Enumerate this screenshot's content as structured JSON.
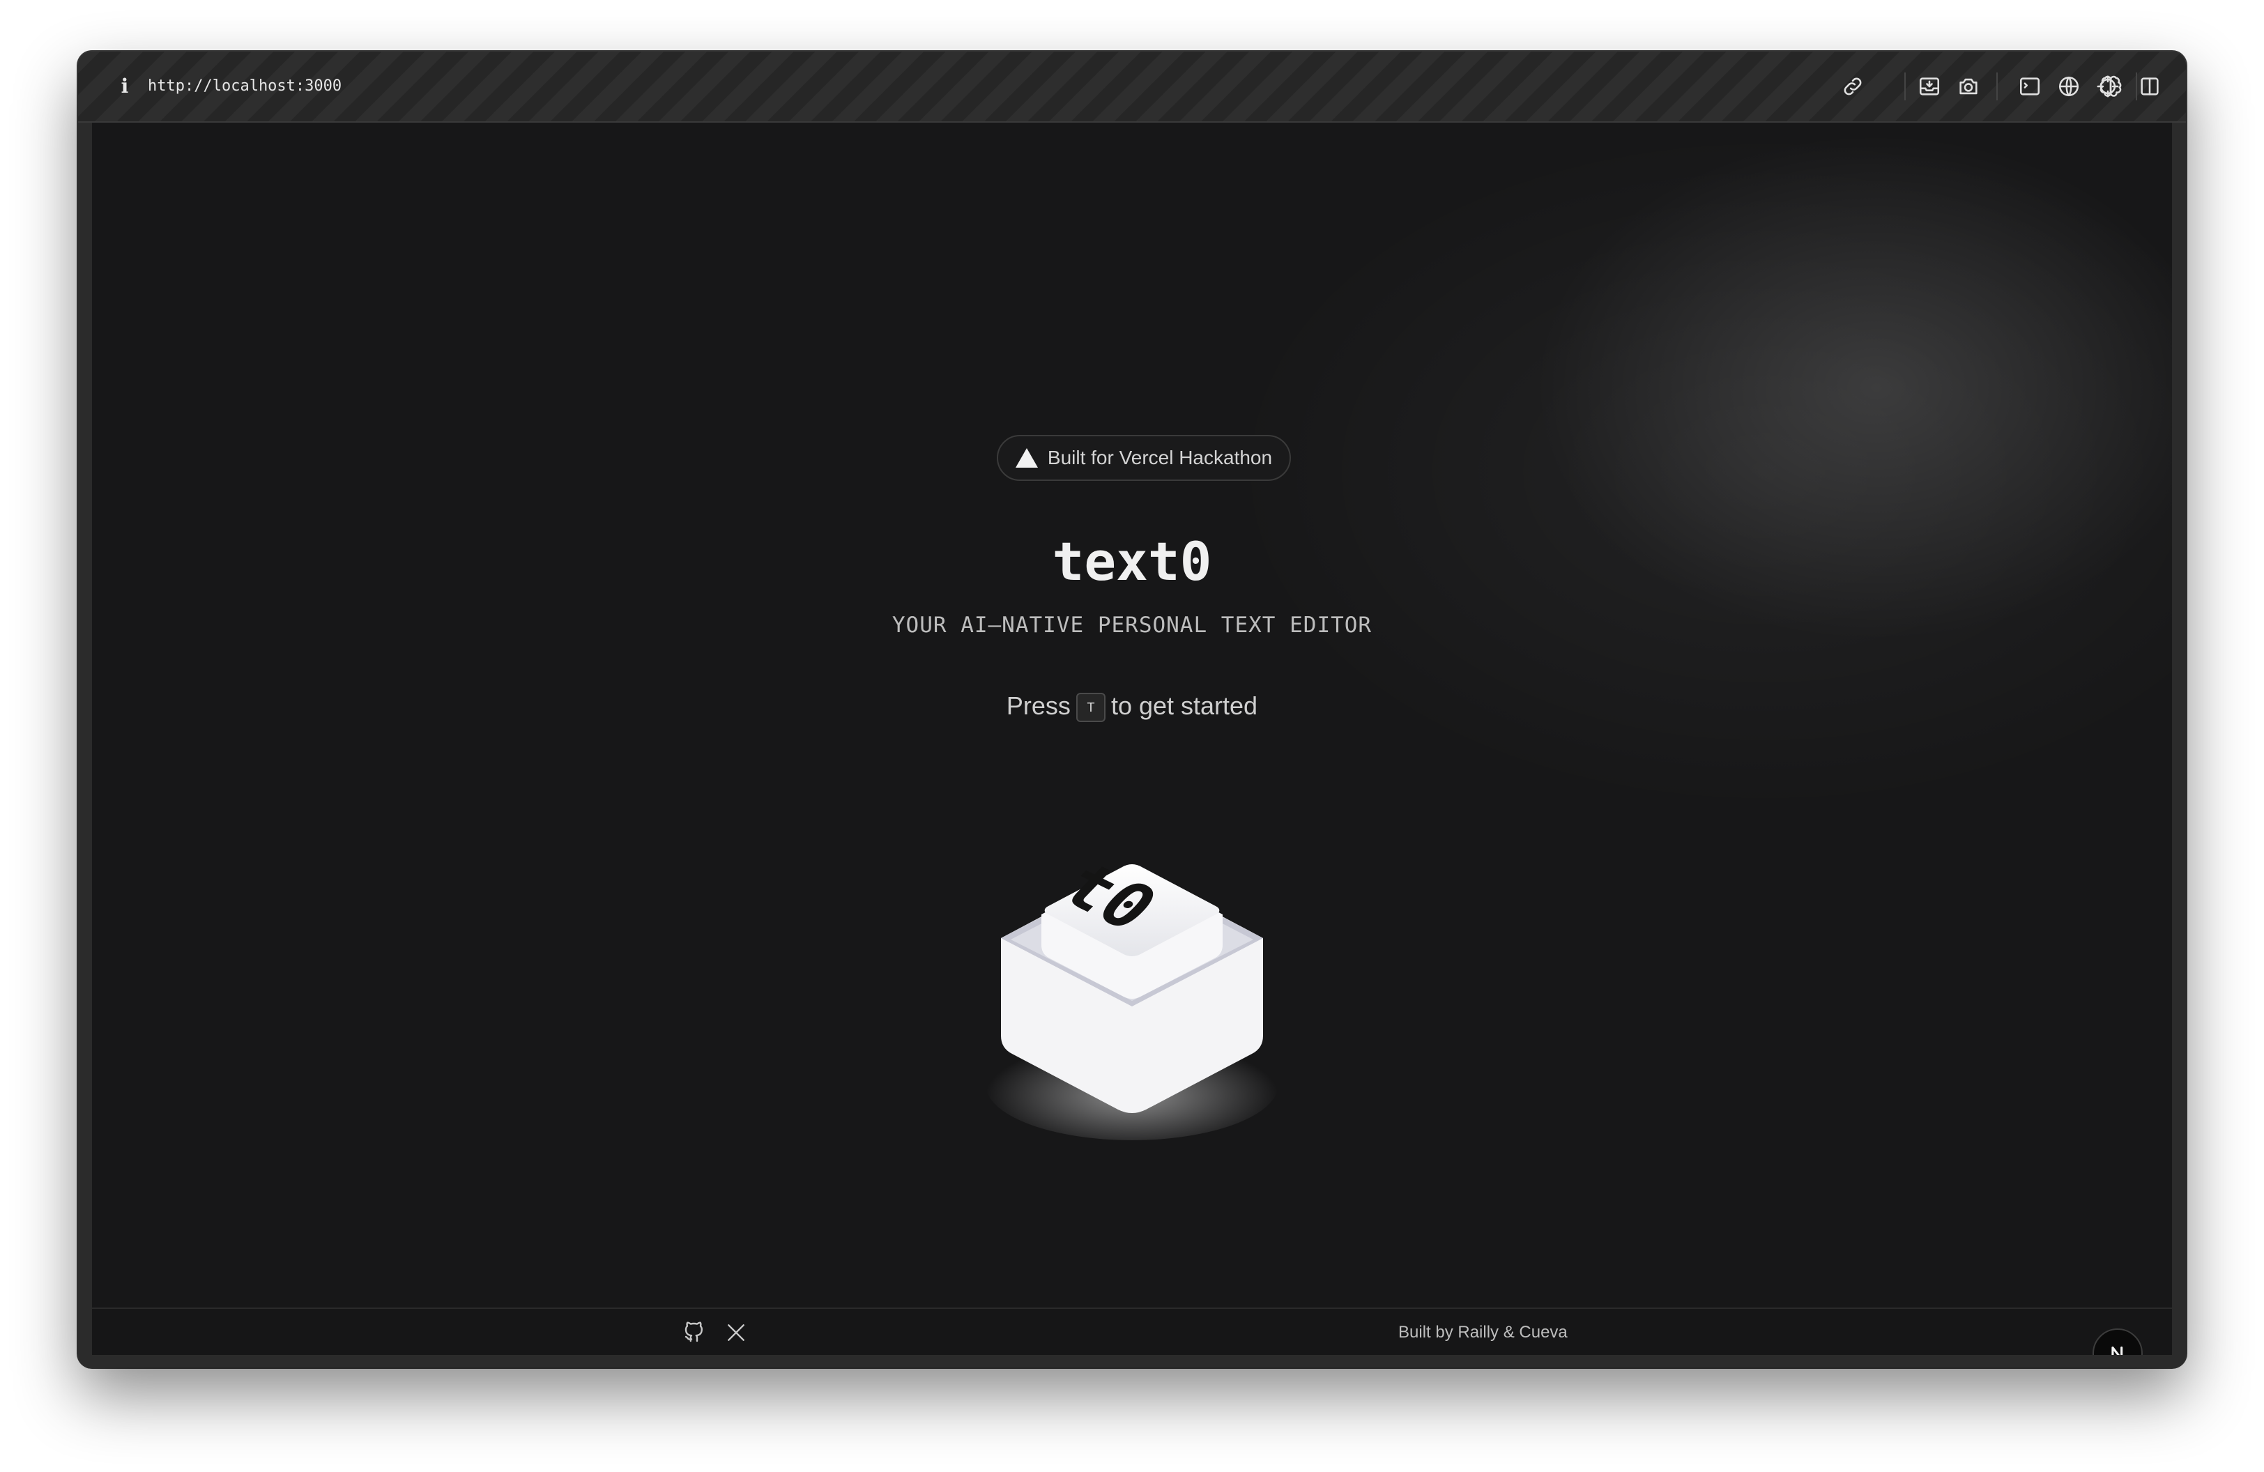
{
  "toolbar": {
    "url": "http://localhost:3000",
    "icons": [
      "info-icon",
      "link-icon",
      "inbox-download-icon",
      "camera-icon",
      "terminal-icon",
      "globe-icon",
      "crosshair-icon",
      "brain-icon",
      "split-panel-icon"
    ]
  },
  "hero": {
    "badge_label": "Built for Vercel Hackathon",
    "title": "text0",
    "subtitle": "YOUR AI–NATIVE PERSONAL TEXT EDITOR",
    "press_prefix": "Press",
    "press_key": "T",
    "press_suffix": "to get started",
    "logo_text": "t0"
  },
  "footer": {
    "credit": "Built by Railly & Cueva",
    "icons": [
      "github-icon",
      "x-icon"
    ]
  },
  "nextjs_badge": "N",
  "colors": {
    "background": "#171718",
    "chrome": "#262626",
    "text_primary": "#f0f0f0",
    "text_secondary": "#bdbdbd"
  }
}
